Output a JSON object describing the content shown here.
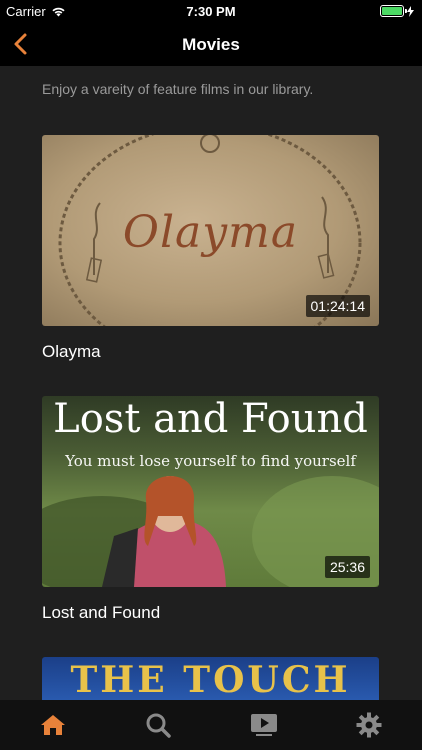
{
  "status_bar": {
    "carrier": "Carrier",
    "time": "7:30 PM"
  },
  "nav": {
    "title": "Movies",
    "back_icon": "chevron-left-icon",
    "accent_color": "#e8823a"
  },
  "intro_text": "Enjoy a vareity of feature films in our library.",
  "movies": [
    {
      "title": "Olayma",
      "duration": "01:24:14",
      "thumb_logo": "Olayma"
    },
    {
      "title": "Lost and Found",
      "duration": "25:36",
      "thumb_title": "Lost and Found",
      "thumb_tagline": "You must lose yourself to find yourself"
    },
    {
      "thumb_title": "THE TOUCH"
    }
  ],
  "tabs": [
    {
      "icon": "home-icon",
      "active": true
    },
    {
      "icon": "search-icon",
      "active": false
    },
    {
      "icon": "video-icon",
      "active": false
    },
    {
      "icon": "gear-icon",
      "active": false
    }
  ]
}
